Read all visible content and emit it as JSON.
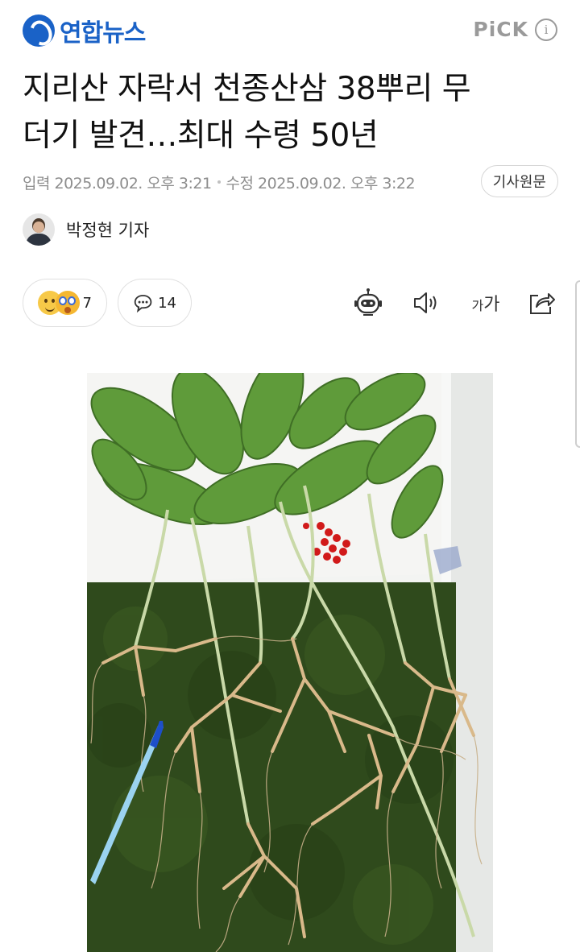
{
  "header": {
    "brand": "연합뉴스",
    "pick_label": "PiCK",
    "info_icon": "info-icon"
  },
  "article": {
    "title_line1": "지리산 자락서 천종산삼 38뿌리 무",
    "title_line2": "더기 발견…최대 수령 50년",
    "published": "입력 2025.09.02. 오후 3:21",
    "modified": "수정 2025.09.02. 오후 3:22",
    "original_button": "기사원문",
    "reporter": "박정현 기자"
  },
  "actions": {
    "reactions_count": "7",
    "comments_count": "14",
    "fontsize_small": "가",
    "fontsize_big": "가",
    "icons": [
      "robot-summary-icon",
      "speaker-icon",
      "font-size-icon",
      "share-icon"
    ]
  },
  "colors": {
    "brand_blue": "#1a62c7",
    "meta_gray": "#8d8d8d",
    "moss_green": "#2f4a1c",
    "leaf_green": "#5f9b3a"
  }
}
